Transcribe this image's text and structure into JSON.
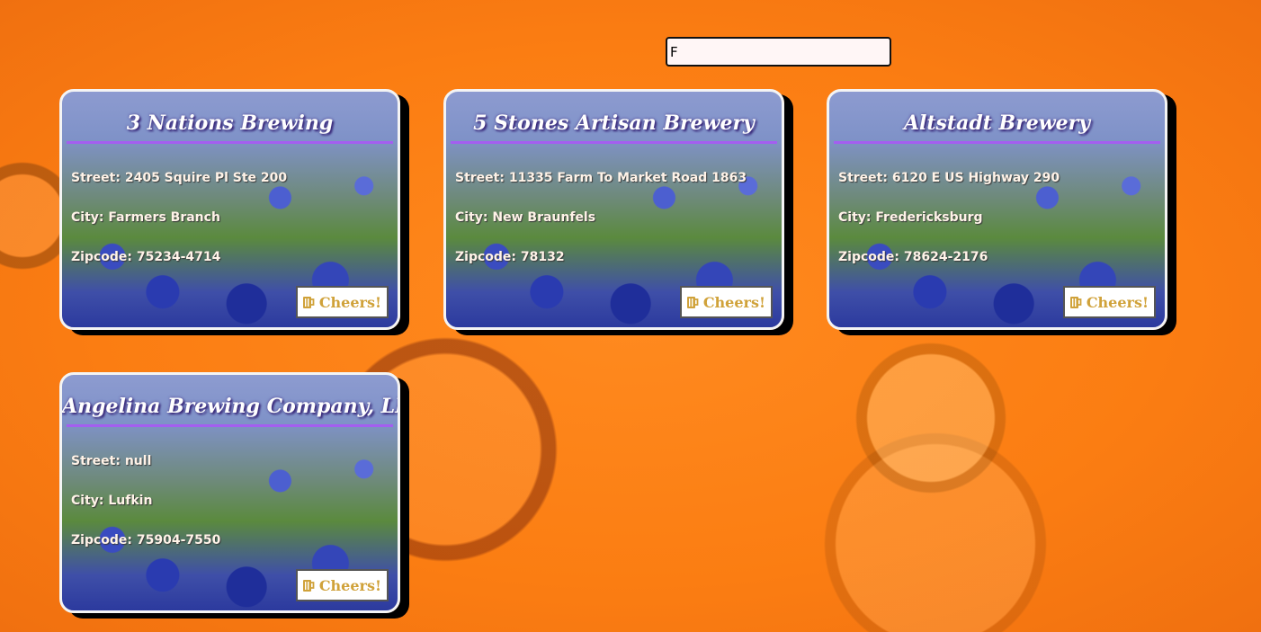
{
  "search": {
    "value": "F"
  },
  "cheers_label": "Cheers!",
  "cheers_icon": "beer-mug-icon",
  "labels": {
    "street": "Street: ",
    "city": "City: ",
    "zip": "Zipcode: "
  },
  "breweries": [
    {
      "name": "3 Nations Brewing",
      "street": "2405 Squire Pl Ste 200",
      "city": "Farmers Branch",
      "zip": "75234-4714"
    },
    {
      "name": "5 Stones Artisan Brewery",
      "street": "11335 Farm To Market Road 1863",
      "city": "New Braunfels",
      "zip": "78132"
    },
    {
      "name": "Altstadt Brewery",
      "street": "6120 E US Highway 290",
      "city": "Fredericksburg",
      "zip": "78624-2176"
    },
    {
      "name": "Angelina Brewing Company, LLC.",
      "street": "null",
      "city": "Lufkin",
      "zip": "75904-7550"
    }
  ],
  "colors": {
    "background": "#fa7f16",
    "title_rule": "#a45ef0",
    "button_text": "#d0a23a"
  }
}
